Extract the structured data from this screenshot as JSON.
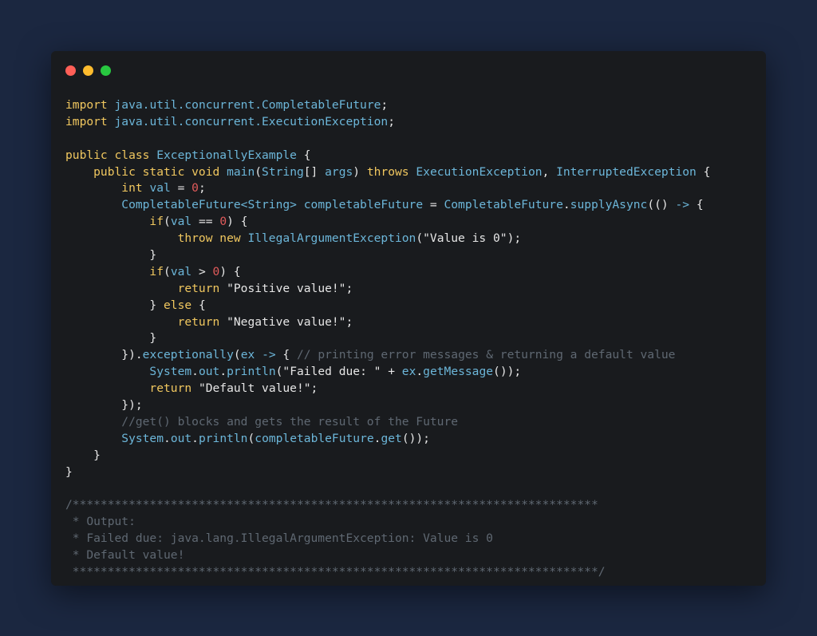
{
  "window": {
    "traffic_lights": [
      {
        "name": "close",
        "color": "#ff5f57"
      },
      {
        "name": "minimize",
        "color": "#febc2e"
      },
      {
        "name": "maximize",
        "color": "#28c840"
      }
    ]
  },
  "colors": {
    "keyword": "#f0c75f",
    "type": "#6cb6d9",
    "number": "#e25b5b",
    "comment": "#5f6872",
    "text": "#e6e6e6",
    "background": "#191b1e",
    "page_background": "#1b2740"
  },
  "code": {
    "lines": [
      [
        {
          "t": "import",
          "c": "kw"
        },
        {
          "t": " ",
          "c": "pl"
        },
        {
          "t": "java.util.concurrent.CompletableFuture",
          "c": "ty"
        },
        {
          "t": ";",
          "c": "pl"
        }
      ],
      [
        {
          "t": "import",
          "c": "kw"
        },
        {
          "t": " ",
          "c": "pl"
        },
        {
          "t": "java.util.concurrent.ExecutionException",
          "c": "ty"
        },
        {
          "t": ";",
          "c": "pl"
        }
      ],
      [],
      [
        {
          "t": "public class",
          "c": "kw"
        },
        {
          "t": " ",
          "c": "pl"
        },
        {
          "t": "ExceptionallyExample",
          "c": "ty"
        },
        {
          "t": " {",
          "c": "pl"
        }
      ],
      [
        {
          "t": "    public static void",
          "c": "kw"
        },
        {
          "t": " ",
          "c": "pl"
        },
        {
          "t": "main",
          "c": "ty"
        },
        {
          "t": "(",
          "c": "pl"
        },
        {
          "t": "String",
          "c": "ty"
        },
        {
          "t": "[] ",
          "c": "pl"
        },
        {
          "t": "args",
          "c": "ty"
        },
        {
          "t": ") ",
          "c": "pl"
        },
        {
          "t": "throws",
          "c": "kw"
        },
        {
          "t": " ",
          "c": "pl"
        },
        {
          "t": "ExecutionException",
          "c": "ty"
        },
        {
          "t": ", ",
          "c": "pl"
        },
        {
          "t": "InterruptedException",
          "c": "ty"
        },
        {
          "t": " {",
          "c": "pl"
        }
      ],
      [
        {
          "t": "        int",
          "c": "kw"
        },
        {
          "t": " ",
          "c": "pl"
        },
        {
          "t": "val",
          "c": "ty"
        },
        {
          "t": " = ",
          "c": "pl"
        },
        {
          "t": "0",
          "c": "num"
        },
        {
          "t": ";",
          "c": "pl"
        }
      ],
      [
        {
          "t": "        CompletableFuture<String>",
          "c": "ty"
        },
        {
          "t": " ",
          "c": "pl"
        },
        {
          "t": "completableFuture",
          "c": "ty"
        },
        {
          "t": " = ",
          "c": "pl"
        },
        {
          "t": "CompletableFuture",
          "c": "ty"
        },
        {
          "t": ".",
          "c": "pl"
        },
        {
          "t": "supplyAsync",
          "c": "ty"
        },
        {
          "t": "(() ",
          "c": "pl"
        },
        {
          "t": "->",
          "c": "ty"
        },
        {
          "t": " {",
          "c": "pl"
        }
      ],
      [
        {
          "t": "            if",
          "c": "kw"
        },
        {
          "t": "(",
          "c": "pl"
        },
        {
          "t": "val",
          "c": "ty"
        },
        {
          "t": " == ",
          "c": "pl"
        },
        {
          "t": "0",
          "c": "num"
        },
        {
          "t": ") {",
          "c": "pl"
        }
      ],
      [
        {
          "t": "                throw new",
          "c": "kw"
        },
        {
          "t": " ",
          "c": "pl"
        },
        {
          "t": "IllegalArgumentException",
          "c": "ty"
        },
        {
          "t": "(",
          "c": "pl"
        },
        {
          "t": "\"Value is 0\"",
          "c": "str"
        },
        {
          "t": ");",
          "c": "pl"
        }
      ],
      [
        {
          "t": "            }",
          "c": "pl"
        }
      ],
      [
        {
          "t": "            if",
          "c": "kw"
        },
        {
          "t": "(",
          "c": "pl"
        },
        {
          "t": "val",
          "c": "ty"
        },
        {
          "t": " > ",
          "c": "pl"
        },
        {
          "t": "0",
          "c": "num"
        },
        {
          "t": ") {",
          "c": "pl"
        }
      ],
      [
        {
          "t": "                return",
          "c": "kw"
        },
        {
          "t": " ",
          "c": "pl"
        },
        {
          "t": "\"Positive value!\"",
          "c": "str"
        },
        {
          "t": ";",
          "c": "pl"
        }
      ],
      [
        {
          "t": "            } ",
          "c": "pl"
        },
        {
          "t": "else",
          "c": "kw"
        },
        {
          "t": " {",
          "c": "pl"
        }
      ],
      [
        {
          "t": "                return",
          "c": "kw"
        },
        {
          "t": " ",
          "c": "pl"
        },
        {
          "t": "\"Negative value!\"",
          "c": "str"
        },
        {
          "t": ";",
          "c": "pl"
        }
      ],
      [
        {
          "t": "            }",
          "c": "pl"
        }
      ],
      [
        {
          "t": "        }).",
          "c": "pl"
        },
        {
          "t": "exceptionally",
          "c": "ty"
        },
        {
          "t": "(",
          "c": "pl"
        },
        {
          "t": "ex",
          "c": "ty"
        },
        {
          "t": " ",
          "c": "pl"
        },
        {
          "t": "->",
          "c": "ty"
        },
        {
          "t": " { ",
          "c": "pl"
        },
        {
          "t": "// printing error messages & returning a default value",
          "c": "cm"
        }
      ],
      [
        {
          "t": "            System",
          "c": "ty"
        },
        {
          "t": ".",
          "c": "pl"
        },
        {
          "t": "out",
          "c": "ty"
        },
        {
          "t": ".",
          "c": "pl"
        },
        {
          "t": "println",
          "c": "ty"
        },
        {
          "t": "(",
          "c": "pl"
        },
        {
          "t": "\"Failed due: \"",
          "c": "str"
        },
        {
          "t": " + ",
          "c": "pl"
        },
        {
          "t": "ex",
          "c": "ty"
        },
        {
          "t": ".",
          "c": "pl"
        },
        {
          "t": "getMessage",
          "c": "ty"
        },
        {
          "t": "());",
          "c": "pl"
        }
      ],
      [
        {
          "t": "            return",
          "c": "kw"
        },
        {
          "t": " ",
          "c": "pl"
        },
        {
          "t": "\"Default value!\"",
          "c": "str"
        },
        {
          "t": ";",
          "c": "pl"
        }
      ],
      [
        {
          "t": "        });",
          "c": "pl"
        }
      ],
      [
        {
          "t": "        //get() blocks and gets the result of the Future",
          "c": "cm"
        }
      ],
      [
        {
          "t": "        System",
          "c": "ty"
        },
        {
          "t": ".",
          "c": "pl"
        },
        {
          "t": "out",
          "c": "ty"
        },
        {
          "t": ".",
          "c": "pl"
        },
        {
          "t": "println",
          "c": "ty"
        },
        {
          "t": "(",
          "c": "pl"
        },
        {
          "t": "completableFuture",
          "c": "ty"
        },
        {
          "t": ".",
          "c": "pl"
        },
        {
          "t": "get",
          "c": "ty"
        },
        {
          "t": "());",
          "c": "pl"
        }
      ],
      [
        {
          "t": "    }",
          "c": "pl"
        }
      ],
      [
        {
          "t": "}",
          "c": "pl"
        }
      ],
      [],
      [
        {
          "t": "/***************************************************************************",
          "c": "cm"
        }
      ],
      [
        {
          "t": " * Output:",
          "c": "cm"
        }
      ],
      [
        {
          "t": " * Failed due: java.lang.IllegalArgumentException: Value is 0",
          "c": "cm"
        }
      ],
      [
        {
          "t": " * Default value!",
          "c": "cm"
        }
      ],
      [
        {
          "t": " ***************************************************************************/",
          "c": "cm"
        }
      ]
    ]
  }
}
